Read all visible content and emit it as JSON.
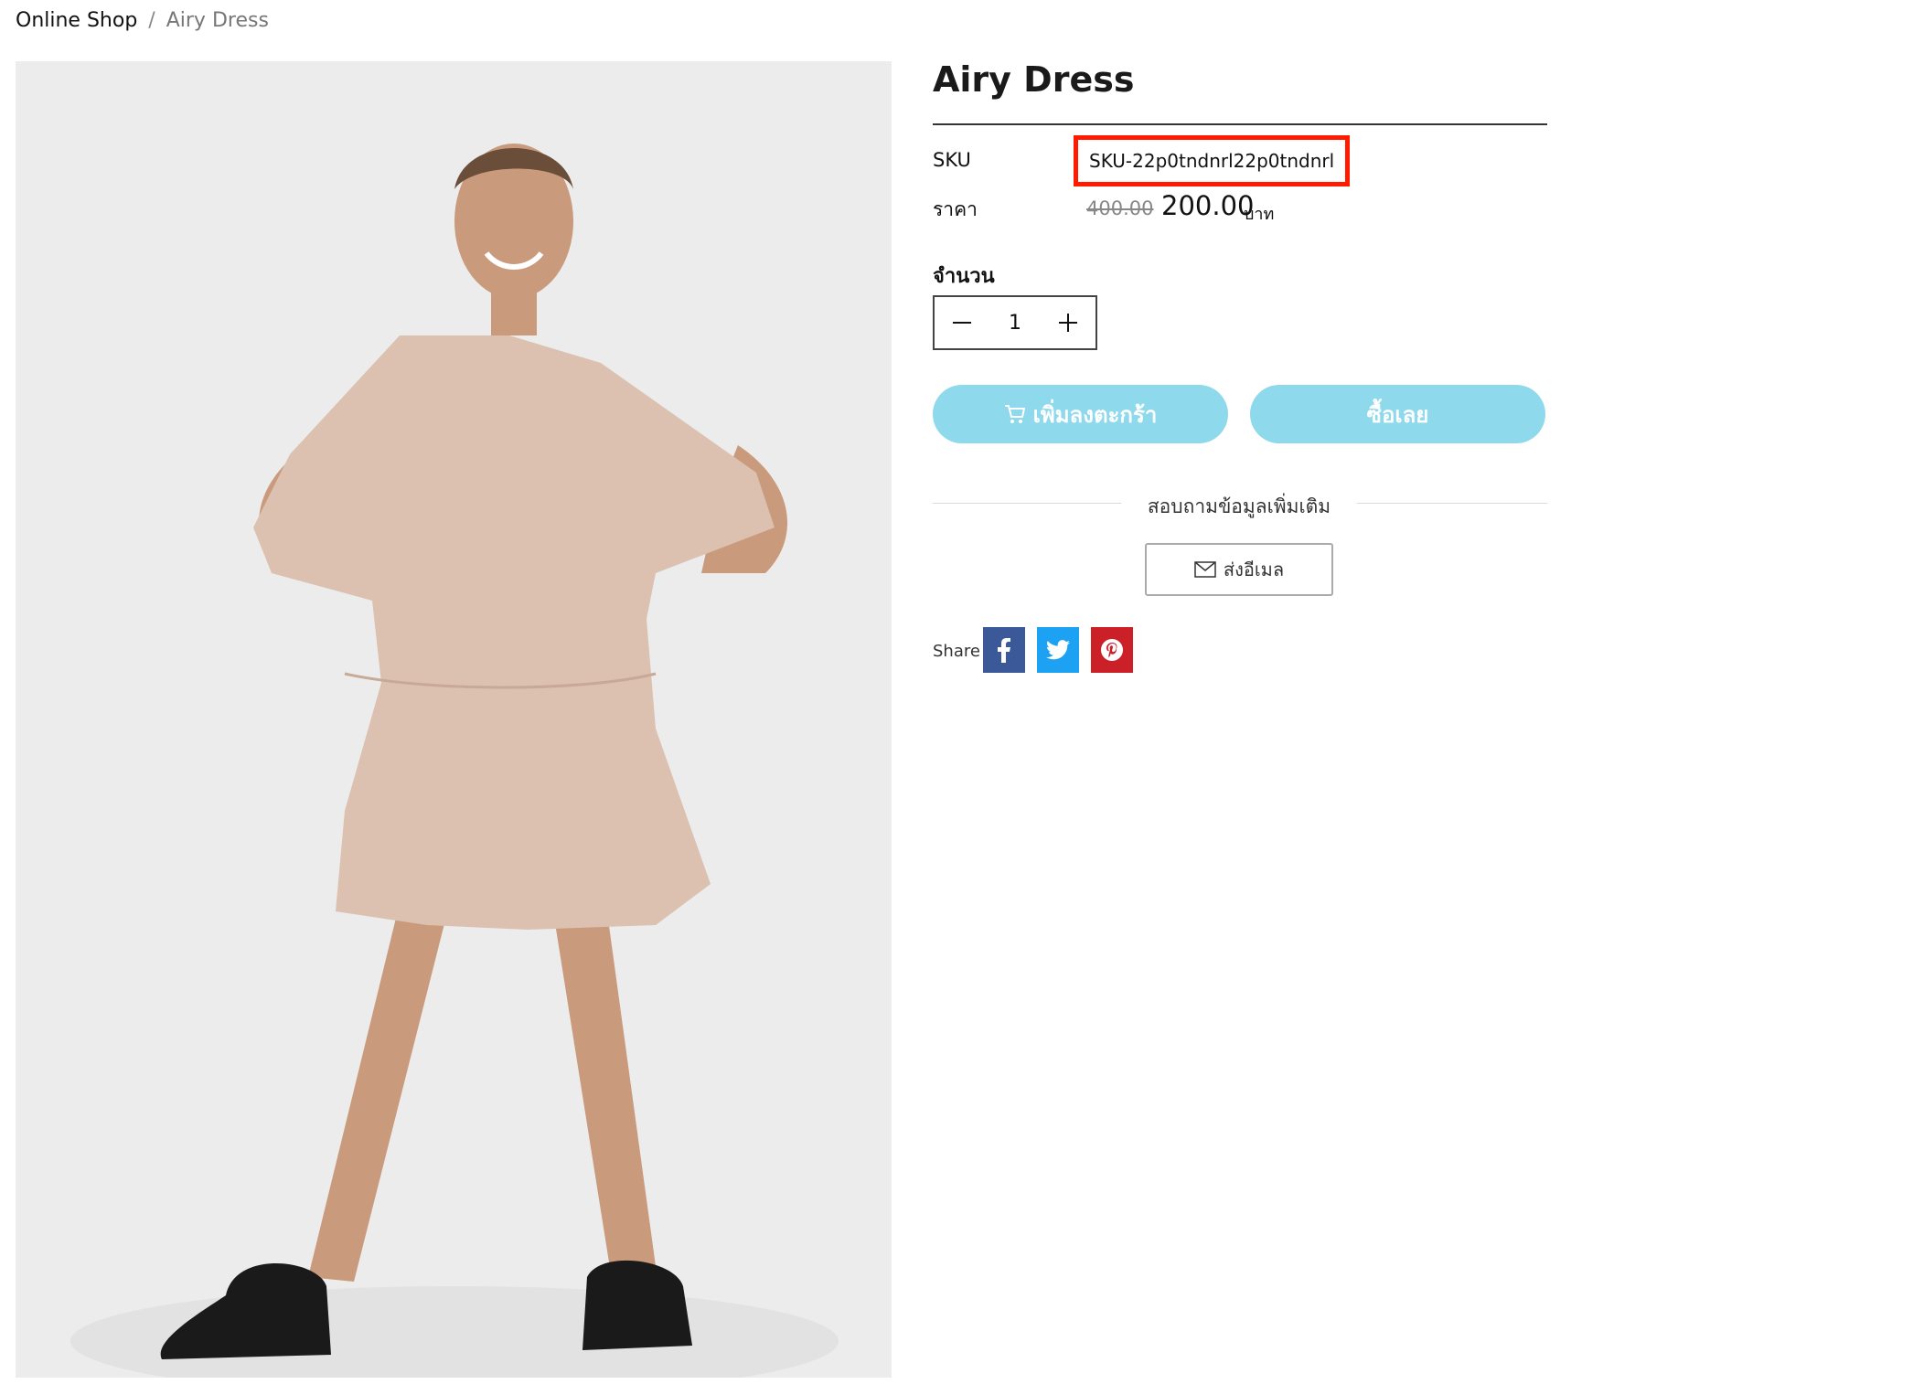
{
  "breadcrumb": {
    "home": "Online Shop",
    "separator": "/",
    "current": "Airy Dress"
  },
  "product": {
    "title": "Airy Dress",
    "sku_label": "SKU",
    "sku_value": "SKU-22p0tndnrl22p0tndnrl",
    "price_label": "ราคา",
    "price_old": "400.00",
    "price_new": "200.00",
    "price_unit": "บาท",
    "quantity_label": "จำนวน",
    "quantity_value": "1"
  },
  "actions": {
    "add_to_cart": "เพิ่มลงตะกร้า",
    "buy_now": "ซื้อเลย"
  },
  "inquiry": {
    "heading": "สอบถามข้อมูลเพิ่มเติม",
    "email_button": "ส่งอีเมล"
  },
  "share": {
    "label": "Share",
    "networks": [
      "facebook-icon",
      "twitter-icon",
      "pinterest-icon"
    ]
  },
  "colors": {
    "accent": "#8fd9ec",
    "highlight": "#ff1a00",
    "facebook": "#3b5998",
    "twitter": "#1da1f2",
    "pinterest": "#cb2027"
  }
}
